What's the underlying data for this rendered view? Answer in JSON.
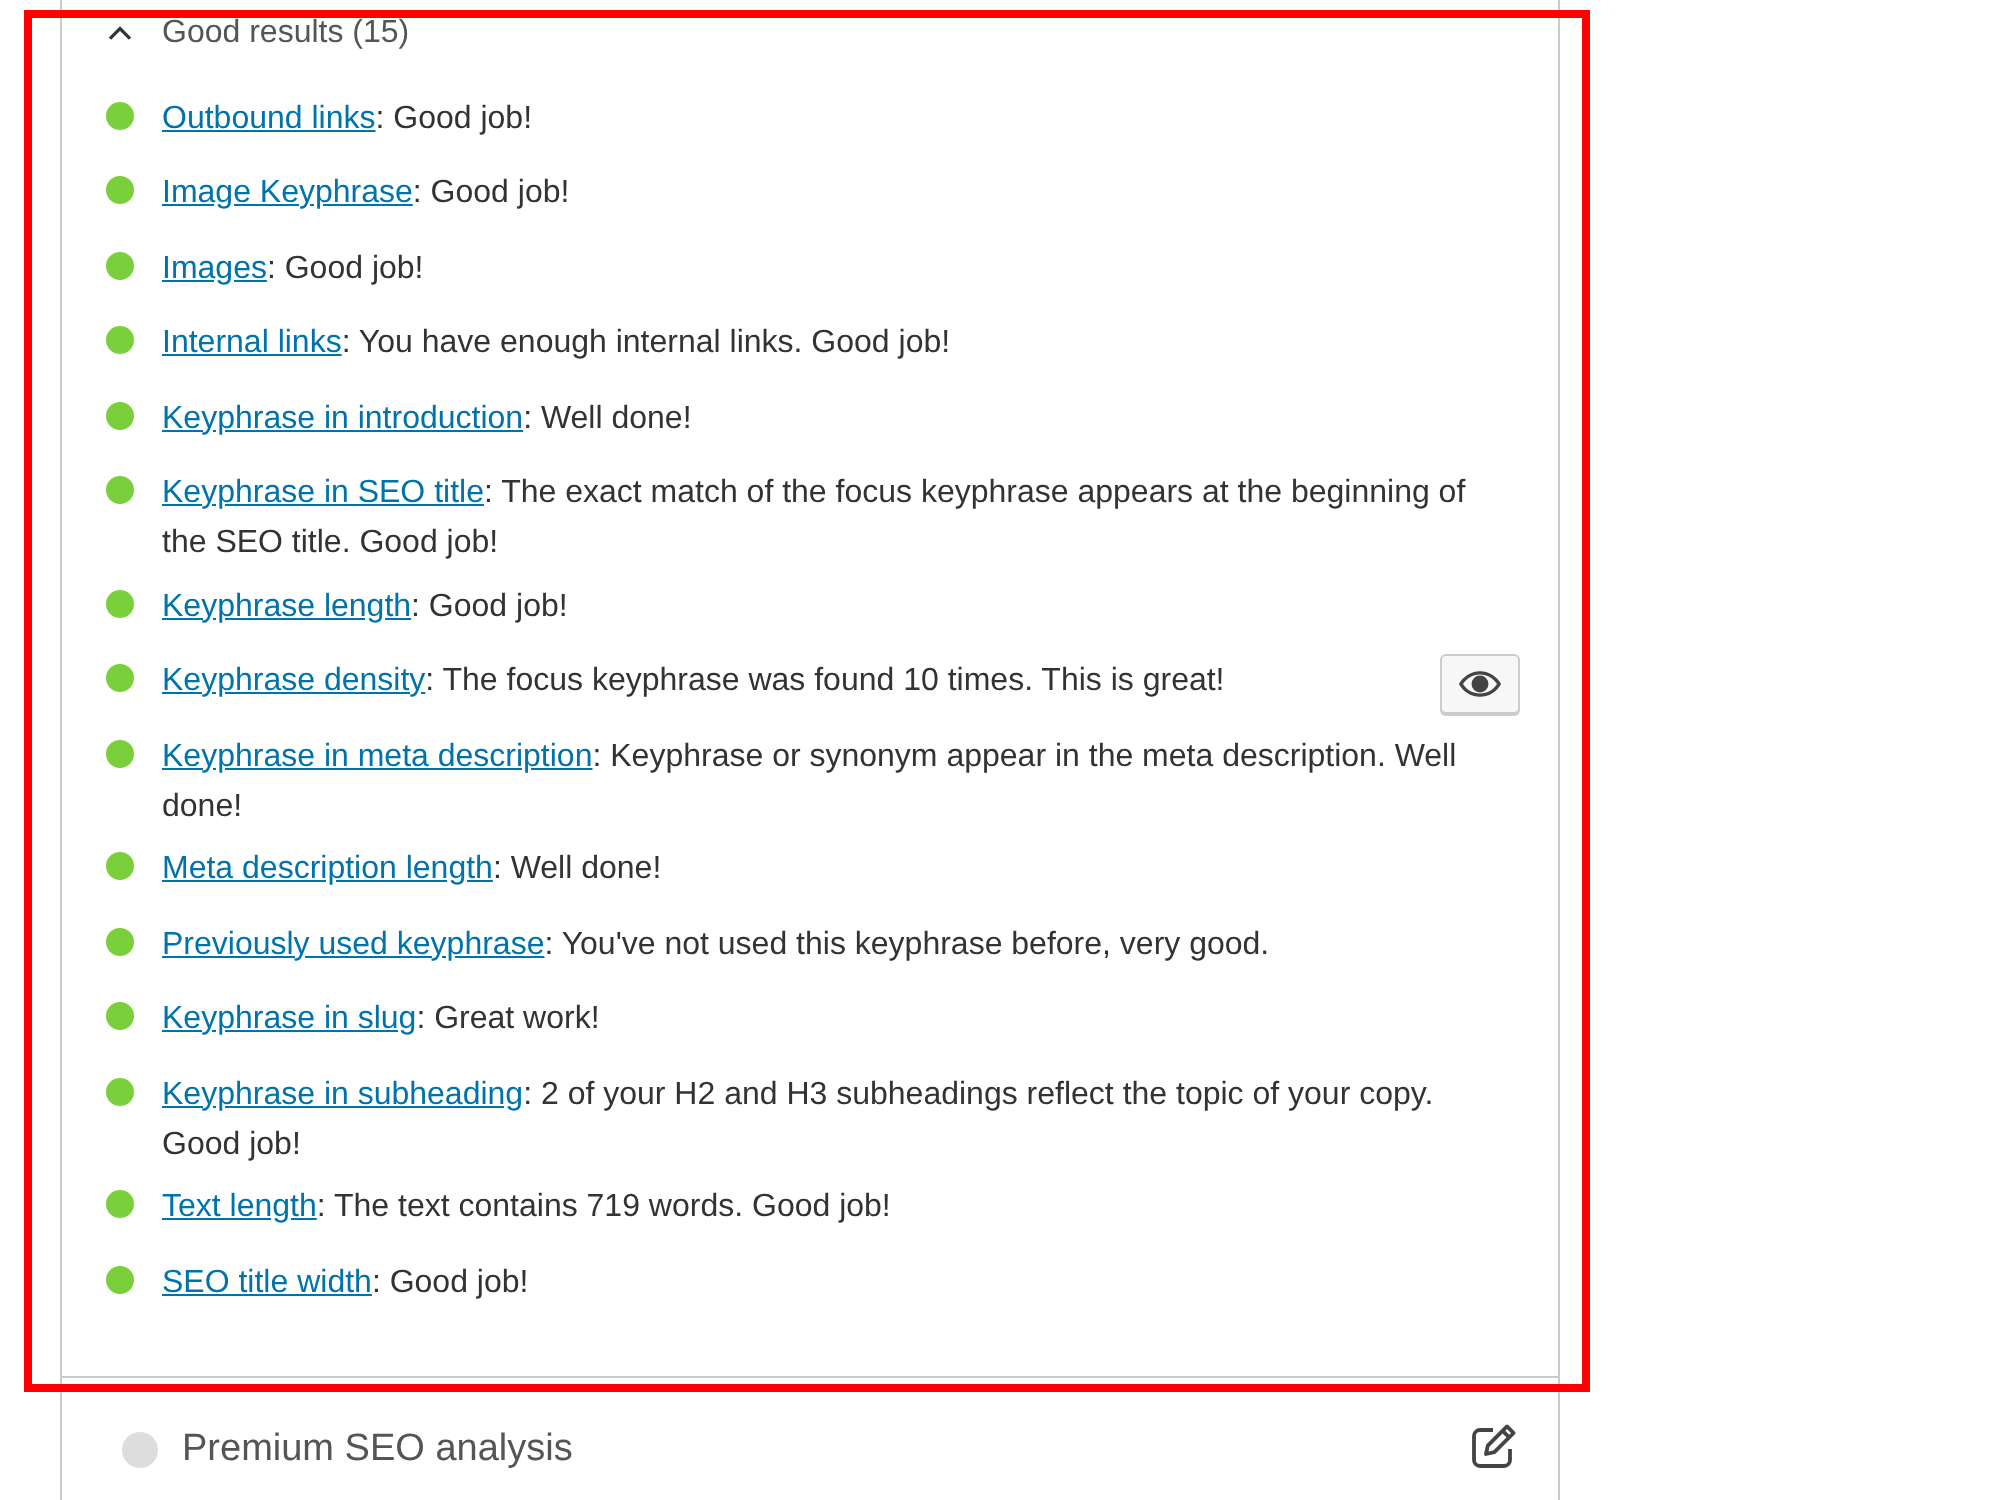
{
  "good_results": {
    "title": "Good results (15)",
    "expanded": true,
    "items": [
      {
        "color": "#7ad03a",
        "label": "Outbound links",
        "text": ": Good job!",
        "marker_button": false
      },
      {
        "color": "#7ad03a",
        "label": "Image Keyphrase",
        "text": ": Good job!",
        "marker_button": false
      },
      {
        "color": "#7ad03a",
        "label": "Images",
        "text": ": Good job!",
        "marker_button": false
      },
      {
        "color": "#7ad03a",
        "label": "Internal links",
        "text": ": You have enough internal links. Good job!",
        "marker_button": false
      },
      {
        "color": "#7ad03a",
        "label": "Keyphrase in introduction",
        "text": ": Well done!",
        "marker_button": false
      },
      {
        "color": "#7ad03a",
        "label": "Keyphrase in SEO title",
        "text": ": The exact match of the focus keyphrase appears at the beginning of the SEO title. Good job!",
        "marker_button": false
      },
      {
        "color": "#7ad03a",
        "label": "Keyphrase length",
        "text": ": Good job!",
        "marker_button": false
      },
      {
        "color": "#7ad03a",
        "label": "Keyphrase density",
        "text": ": The focus keyphrase was found 10 times. This is great!",
        "marker_button": true
      },
      {
        "color": "#7ad03a",
        "label": "Keyphrase in meta description",
        "text": ": Keyphrase or synonym appear in the meta description. Well done!",
        "marker_button": false
      },
      {
        "color": "#7ad03a",
        "label": "Meta description length",
        "text": ": Well done!",
        "marker_button": false
      },
      {
        "color": "#7ad03a",
        "label": "Previously used keyphrase",
        "text": ": You've not used this keyphrase before, very good.",
        "marker_button": false
      },
      {
        "color": "#7ad03a",
        "label": "Keyphrase in slug",
        "text": ": Great work!",
        "marker_button": false
      },
      {
        "color": "#7ad03a",
        "label": "Keyphrase in subheading",
        "text": ": 2 of your H2 and H3 subheadings reflect the topic of your copy. Good job!",
        "marker_button": false
      },
      {
        "color": "#7ad03a",
        "label": "Text length",
        "text": ": The text contains 719 words. Good job!",
        "marker_button": false
      },
      {
        "color": "#7ad03a",
        "label": "SEO title width",
        "text": ": Good job!",
        "marker_button": false
      }
    ]
  },
  "premium_analysis": {
    "title": "Premium SEO analysis",
    "color": "#dddddd"
  },
  "annotation": {
    "kind": "outline"
  }
}
